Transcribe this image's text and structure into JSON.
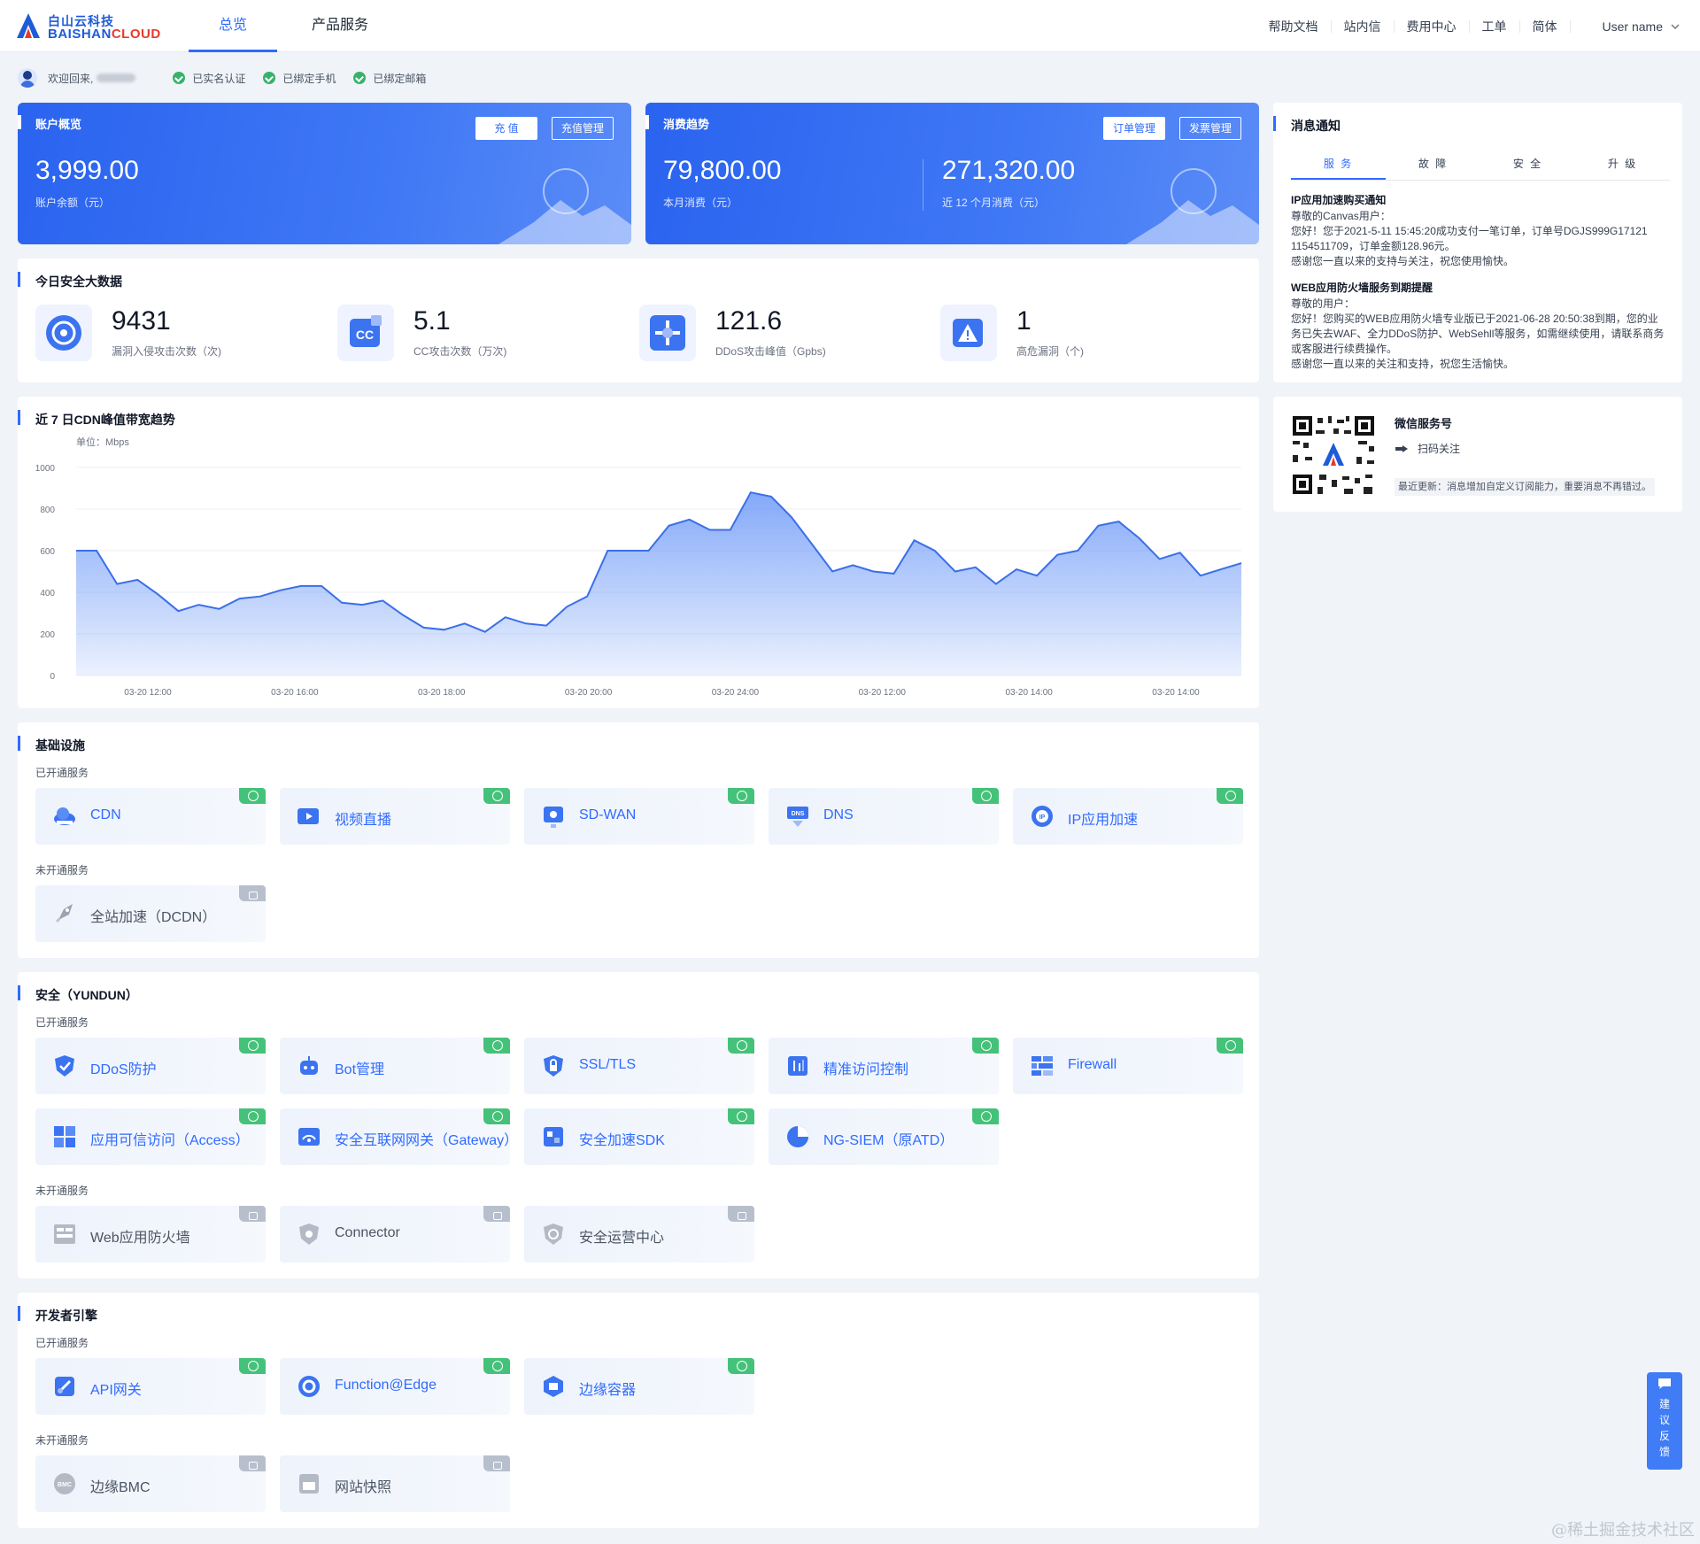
{
  "brand": {
    "name_cn": "白山云科技",
    "name_en_a": "BAISHAN",
    "name_en_b": "CLOUD"
  },
  "nav": {
    "tabs": [
      {
        "label": "总览",
        "active": true
      },
      {
        "label": "产品服务",
        "active": false
      }
    ]
  },
  "header_links": [
    "帮助文档",
    "站内信",
    "费用中心",
    "工单",
    "简体"
  ],
  "user": {
    "name": "User name",
    "icon": "chevron-down-icon"
  },
  "welcome": {
    "text": "欢迎回来,",
    "checks": [
      "已实名认证",
      "已绑定手机",
      "已绑定邮箱"
    ]
  },
  "account": {
    "title": "账户概览",
    "recharge": "充 值",
    "recharge_mgmt": "充值管理",
    "balance": "3,999.00",
    "balance_label": "账户余额（元）"
  },
  "consume": {
    "title": "消费趋势",
    "order_mgmt": "订单管理",
    "invoice_mgmt": "发票管理",
    "month": "79,800.00",
    "month_label": "本月消费（元）",
    "year": "271,320.00",
    "year_label": "近 12 个月消费（元）"
  },
  "security": {
    "title": "今日安全大数据",
    "stats": [
      {
        "value": "9431",
        "label": "漏洞入侵攻击次数（次)",
        "icon": "target-icon"
      },
      {
        "value": "5.1",
        "label": "CC攻击次数（万次)",
        "icon": "cc-icon"
      },
      {
        "value": "121.6",
        "label": "DDoS攻击峰值（Gpbs)",
        "icon": "ddos-icon"
      },
      {
        "value": "1",
        "label": "高危漏洞（个)",
        "icon": "warning-icon"
      }
    ]
  },
  "bandwidth": {
    "title": "近 7 日CDN峰值带宽趋势",
    "unit": "单位：Mbps"
  },
  "chart_data": {
    "type": "area",
    "title": "近 7 日CDN峰值带宽趋势",
    "ylabel": "单位：Mbps",
    "ylim": [
      0,
      1000
    ],
    "yticks": [
      0,
      200,
      400,
      600,
      800,
      1000
    ],
    "xticks": [
      "03-20 12:00",
      "03-20 16:00",
      "03-20 18:00",
      "03-20 20:00",
      "03-20 24:00",
      "03-20 12:00",
      "03-20 14:00",
      "03-20 14:00"
    ],
    "color": "#5b8cf7",
    "values": [
      600,
      600,
      440,
      460,
      390,
      310,
      340,
      320,
      370,
      380,
      410,
      430,
      430,
      350,
      340,
      360,
      290,
      230,
      220,
      250,
      210,
      280,
      250,
      240,
      330,
      380,
      600,
      600,
      600,
      720,
      750,
      700,
      700,
      880,
      860,
      760,
      630,
      500,
      530,
      500,
      490,
      650,
      600,
      500,
      520,
      440,
      510,
      480,
      580,
      600,
      720,
      740,
      660,
      560,
      590,
      480,
      510,
      540
    ]
  },
  "infra": {
    "title": "基础设施",
    "opened": "已开通服务",
    "unopened": "未开通服务",
    "on": [
      {
        "name": "CDN",
        "icon": "cloud-icon"
      },
      {
        "name": "视频直播",
        "icon": "video-icon"
      },
      {
        "name": "SD-WAN",
        "icon": "network-icon"
      },
      {
        "name": "DNS",
        "icon": "dns-icon"
      },
      {
        "name": "IP应用加速",
        "icon": "ip-icon"
      }
    ],
    "off": [
      {
        "name": "全站加速（DCDN）",
        "icon": "rocket-icon"
      }
    ]
  },
  "sec": {
    "title": "安全（YUNDUN）",
    "opened": "已开通服务",
    "unopened": "未开通服务",
    "on": [
      {
        "name": "DDoS防护",
        "icon": "shield-icon"
      },
      {
        "name": "Bot管理",
        "icon": "bot-icon"
      },
      {
        "name": "SSL/TLS",
        "icon": "lock-icon"
      },
      {
        "name": "精准访问控制",
        "icon": "filter-icon"
      },
      {
        "name": "Firewall",
        "icon": "firewall-icon"
      },
      {
        "name": "应用可信访问（Access）",
        "icon": "grid-icon"
      },
      {
        "name": "安全互联网网关（Gateway）",
        "icon": "gateway-icon"
      },
      {
        "name": "安全加速SDK",
        "icon": "sdk-icon"
      },
      {
        "name": "NG-SIEM（原ATD）",
        "icon": "pie-icon"
      }
    ],
    "off": [
      {
        "name": "Web应用防火墙",
        "icon": "waf-icon"
      },
      {
        "name": "Connector",
        "icon": "connector-icon"
      },
      {
        "name": "安全运营中心",
        "icon": "soc-icon"
      }
    ]
  },
  "dev": {
    "title": "开发者引擎",
    "opened": "已开通服务",
    "unopened": "未开通服务",
    "on": [
      {
        "name": "API网关",
        "icon": "api-icon"
      },
      {
        "name": "Function@Edge",
        "icon": "function-icon"
      },
      {
        "name": "边缘容器",
        "icon": "container-icon"
      }
    ],
    "off": [
      {
        "name": "边缘BMC",
        "icon": "bmc-icon"
      },
      {
        "name": "网站快照",
        "icon": "snapshot-icon"
      }
    ]
  },
  "notice": {
    "title": "消息通知",
    "tabs": [
      "服 务",
      "故 障",
      "安 全",
      "升 级"
    ],
    "m1_title": "IP应用加速购买通知",
    "m1_l1": "尊敬的Canvas用户：",
    "m1_l2": "您好！您于2021-5-11 15:45:20成功支付一笔订单，订单号DGJS999G17121 1154511709，订单金额128.96元。",
    "m1_l3": "感谢您一直以来的支持与关注，祝您使用愉快。",
    "m2_title": "WEB应用防火墙服务到期提醒",
    "m2_l1": "尊敬的用户：",
    "m2_l2": "您好！您购买的WEB应用防火墙专业版已于2021-06-28 20:50:38到期，您的业务已失去WAF、全力DDoS防护、WebSehll等服务，如需继续使用，请联系商务或客服进行续费操作。",
    "m2_l3": "感谢您一直以来的关注和支持，祝您生活愉快。"
  },
  "wechat": {
    "title": "微信服务号",
    "scan": "扫码关注",
    "update": "最近更新：消息增加自定义订阅能力，重要消息不再错过。"
  },
  "feedback": [
    "建",
    "议",
    "反",
    "馈"
  ],
  "watermark": "@稀土掘金技术社区"
}
